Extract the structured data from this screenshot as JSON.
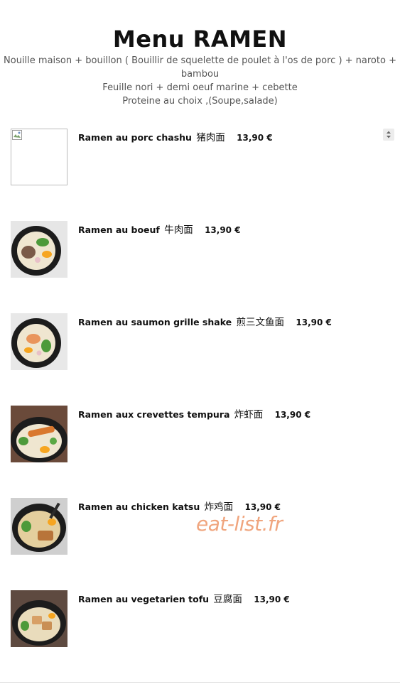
{
  "menu": {
    "title": "Menu RAMEN",
    "description_lines": [
      "Nouille maison + bouillon ( Bouillir de squelette de poulet à l'os de porc ) + naroto + bambou",
      "Feuille nori + demi oeuf marine + cebette",
      "Proteine au choix ,(Soupe,salade)"
    ]
  },
  "items": [
    {
      "name": "Ramen au porc chashu",
      "chinese": "猪肉面",
      "price": "13,90 €"
    },
    {
      "name": "Ramen au boeuf",
      "chinese": "牛肉面",
      "price": "13,90 €"
    },
    {
      "name": "Ramen au saumon grille shake",
      "chinese": "煎三文鱼面",
      "price": "13,90 €"
    },
    {
      "name": "Ramen aux crevettes tempura",
      "chinese": "炸虾面",
      "price": "13,90 €"
    },
    {
      "name": "Ramen au chicken katsu",
      "chinese": "炸鸡面",
      "price": "13,90 €"
    },
    {
      "name": "Ramen au vegetarien tofu",
      "chinese": "豆腐面",
      "price": "13,90 €"
    }
  ],
  "watermark": "eat-list.fr",
  "icons": {
    "stepper": "up-down-stepper-icon",
    "broken_image": "broken-image-icon"
  },
  "colors": {
    "watermark": "#f0a57e",
    "bowl": "#1c1c1c",
    "broth": "#efe6d0"
  }
}
